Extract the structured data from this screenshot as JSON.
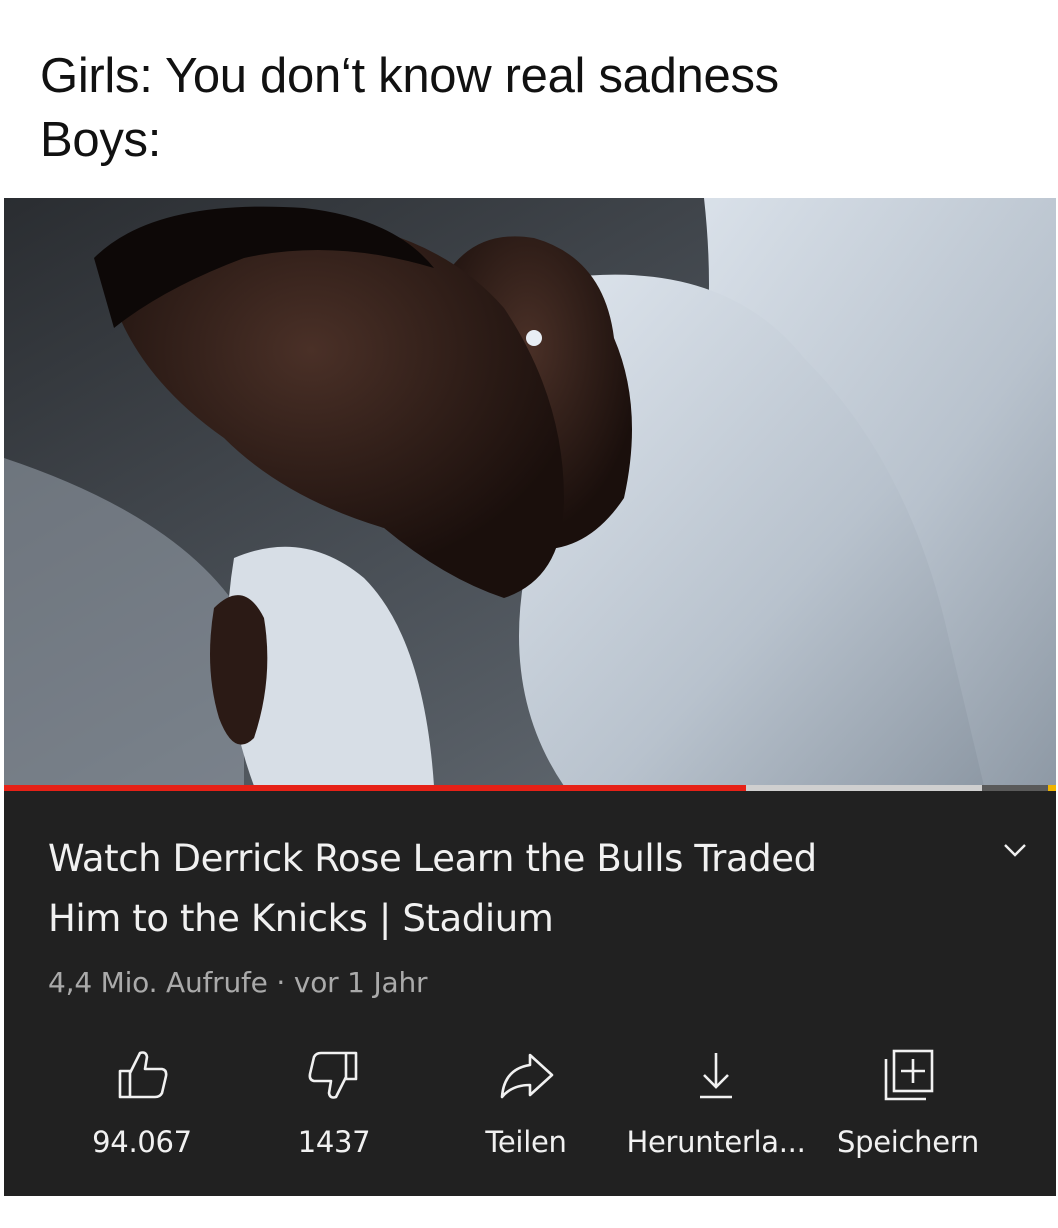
{
  "caption": {
    "line1": "Girls: You don‘t know real sadness",
    "line2": "Boys:"
  },
  "player": {
    "progress_played": 0.705,
    "progress_buffered": 0.93,
    "colors": {
      "played": "#e62117",
      "buffered": "#cfcfcf",
      "ad_marker": "#f0b400"
    }
  },
  "video": {
    "title_line1": "Watch Derrick Rose Learn the Bulls Traded",
    "title_line2": "Him to the Knicks | Stadium",
    "views": "4,4 Mio. Aufrufe",
    "separator": " · ",
    "age": "vor 1 Jahr",
    "expand_icon": "chevron-down-icon"
  },
  "actions": [
    {
      "icon": "thumbs-up-icon",
      "label": "94.067"
    },
    {
      "icon": "thumbs-down-icon",
      "label": "1437"
    },
    {
      "icon": "share-icon",
      "label": "Teilen"
    },
    {
      "icon": "download-icon",
      "label": "Herunterla..."
    },
    {
      "icon": "save-playlist-icon",
      "label": "Speichern"
    }
  ]
}
